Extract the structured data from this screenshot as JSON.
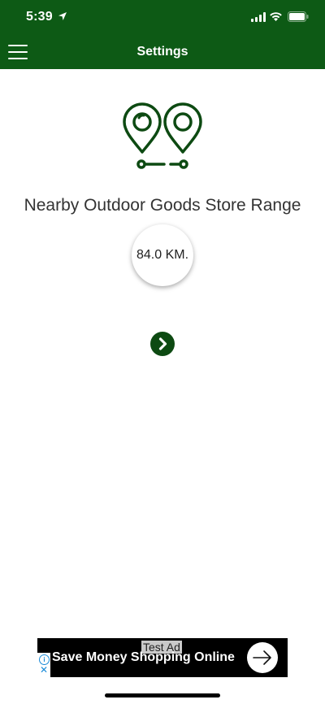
{
  "status_bar": {
    "time": "5:39",
    "icons": [
      "location-arrow-icon",
      "signal-icon",
      "wifi-icon",
      "battery-icon"
    ]
  },
  "header": {
    "title": "Settings",
    "menu_icon": "hamburger-menu-icon"
  },
  "main": {
    "icon": "two-location-pins-route-icon",
    "range_label": "Nearby Outdoor Goods Store Range",
    "range_value": "84.0 KM.",
    "next_icon": "chevron-right-icon"
  },
  "ad": {
    "badge": "Test Ad",
    "headline": "Save Money Shopping Online",
    "info_icon": "i",
    "close_icon": "✕",
    "cta_icon": "arrow-right-icon"
  },
  "colors": {
    "brand": "#0d5a15",
    "icon_green": "#0d4a12",
    "text": "#333333",
    "ad_background": "#000000"
  }
}
